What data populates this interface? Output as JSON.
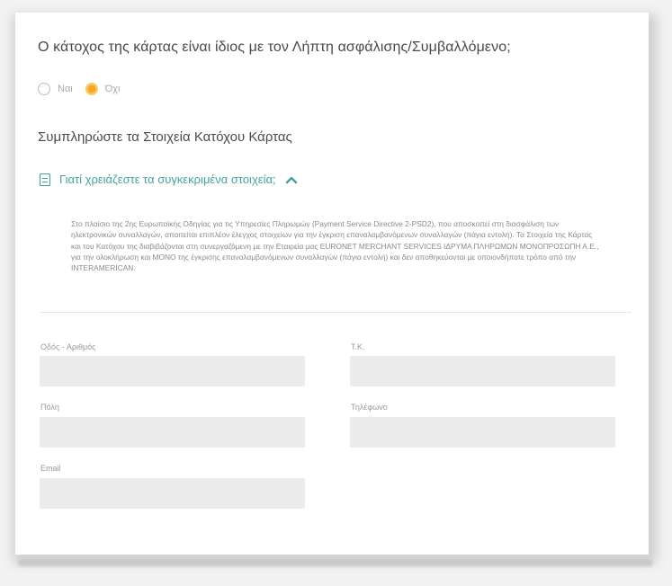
{
  "question": {
    "text": "Ο κάτοχος της κάρτας είναι ίδιος με τον Λήπτη ασφάλισης/Συμβαλλόμενο;"
  },
  "radio_options": [
    {
      "label": "Ναι",
      "selected": false
    },
    {
      "label": "Όχι",
      "selected": true
    }
  ],
  "section": {
    "heading": "Συμπληρώστε τα Στοιχεία Κατόχου Κάρτας"
  },
  "why_link": {
    "label": "Γιατί χρειάζεστε τα συγκεκριμένα στοιχεία;",
    "icon": "document-icon",
    "toggle_icon": "chevron-up-icon"
  },
  "info_text": "Στο πλαίσιο της 2ης Ευρωπαϊκής Οδηγίας για τις Υπηρεσίες Πληρωμών (Payment Service Directive 2-PSD2), που αποσκοπεί στη διασφάλιση των ηλεκτρονικών συναλλαγών, απαιτείται επιπλέον έλεγχος στοιχείων για την έγκριση επαναλαμβανόμενων συναλλαγών (πάγια εντολή). Τα Στοιχεία της Κάρτας και του Κατόχου της διαβιβάζονται στη συνεργαζόμενη με την Εταιρεία μας EURONET MERCHANT SERVICES ΙΔΡΥΜΑ ΠΛΗΡΩΜΩΝ ΜΟΝΟΠΡΟΣΩΠΗ Α.Ε., για την ολοκλήρωση και ΜΟΝΟ της έγκρισης επαναλαμβανόμενων συναλλαγών (πάγια εντολή) και δεν αποθηκεύονται με οποιονδήποτε τρόπο από την INTERAMERICAN.",
  "fields": {
    "street": {
      "label": "Οδός - Αριθμός",
      "value": ""
    },
    "postal_code": {
      "label": "Τ.Κ.",
      "value": ""
    },
    "city": {
      "label": "Πόλη",
      "value": ""
    },
    "phone": {
      "label": "Τηλέφωνο",
      "value": ""
    },
    "email": {
      "label": "Email",
      "value": ""
    }
  },
  "colors": {
    "accent_teal": "#46a39a",
    "radio_selected": "#f5a623",
    "input_background": "#ececec"
  }
}
